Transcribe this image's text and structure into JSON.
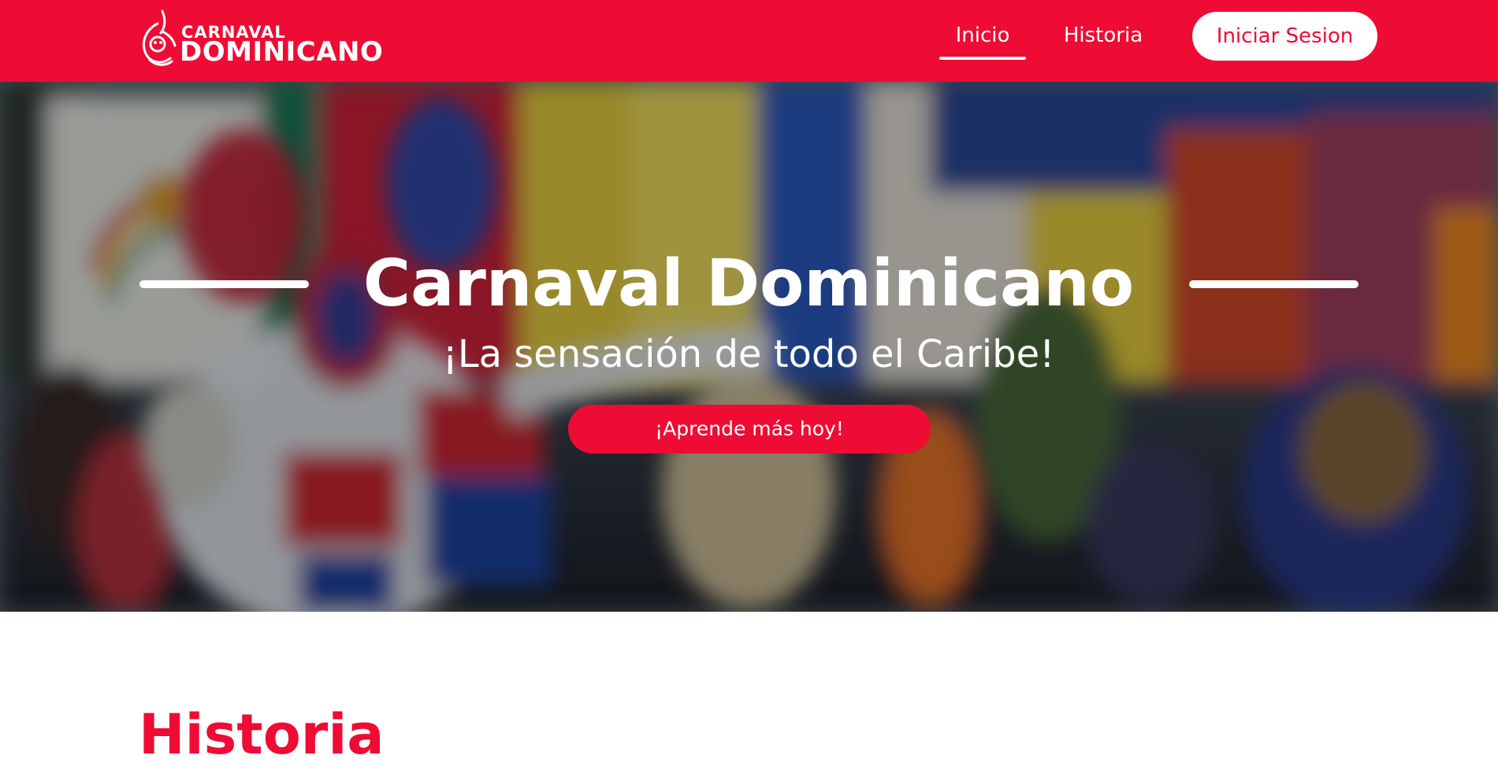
{
  "colors": {
    "brand": "#EE0C34",
    "text_on_brand": "#FFFFFF"
  },
  "nav": {
    "logo": {
      "top_text": "CARNAVAL",
      "bottom_text": "DOMINICANO",
      "icon": "mask-logo-icon"
    },
    "links": [
      {
        "label": "Inicio",
        "active": true
      },
      {
        "label": "Historia",
        "active": false
      }
    ],
    "login_label": "Iniciar Sesion"
  },
  "hero": {
    "title": "Carnaval Dominicano",
    "subtitle": "¡La sensación de todo el Caribe!",
    "cta_label": "¡Aprende más hoy!"
  },
  "sections": {
    "historia_title": "Historia"
  }
}
